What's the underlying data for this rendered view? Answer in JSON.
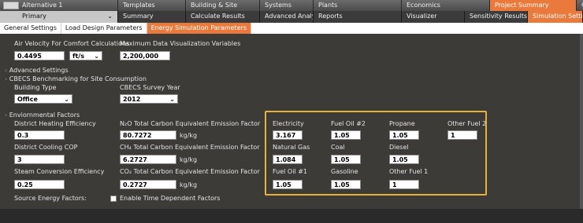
{
  "top_tabs": [
    {
      "label": "Alternative 1",
      "active": false
    },
    {
      "label": "Templates",
      "active": false
    },
    {
      "label": "Building & Site",
      "active": false
    },
    {
      "label": "Systems",
      "active": false
    },
    {
      "label": "Plants",
      "active": false
    },
    {
      "label": "Economics",
      "active": false
    },
    {
      "label": "Project Summary",
      "active": true
    },
    {
      "label": "C",
      "active": false
    }
  ],
  "second_tabs": [
    {
      "label": "Primary"
    },
    {
      "label": "Summary"
    },
    {
      "label": "Calculate Results"
    },
    {
      "label": "Advanced Analytics"
    },
    {
      "label": "Reports"
    },
    {
      "label": "Visualizer"
    },
    {
      "label": "Sensitivity Results"
    },
    {
      "label": "Simulation Settings",
      "active": true
    }
  ],
  "third_tabs": [
    {
      "label": "General Settings"
    },
    {
      "label": "Load Design Parameters"
    },
    {
      "label": "Energy Simulation Parameters",
      "active": true
    }
  ],
  "form": {
    "air_velocity_label": "Air Velocity For Comfort Calculations",
    "air_velocity_value": "0.4495",
    "air_velocity_unit": "ft/s",
    "max_vis_label": "Maximum Data Visualization Variables",
    "max_vis_value": "2,200,000",
    "advanced_settings": "Advanced Settings",
    "cbecs_header": "CBECS Benchmarking for Site Consumption",
    "building_type_label": "Building Type",
    "building_type_value": "Office",
    "cbecs_year_label": "CBECS Survey Year",
    "cbecs_year_value": "2012",
    "env_factors": "Enviornmental Factors",
    "district_heating_label": "District Heating Efficiency",
    "district_heating_value": "0.3",
    "n2o_label": "N₂O Total Carbon Equivalent Emission Factor",
    "n2o_value": "80.7272",
    "n2o_unit": "kg/kg",
    "district_cooling_label": "District Cooling COP",
    "district_cooling_value": "3",
    "ch4_label": "CH₄ Total Carbon Equivalent Emission Factor",
    "ch4_value": "6.2727",
    "ch4_unit": "kg/kg",
    "steam_label": "Steam Conversion Efficiency",
    "steam_value": "0.25",
    "co2_label": "CO₂ Total Carbon Equivalent Emission Factor",
    "co2_value": "0.2727",
    "co2_unit": "kg/kg",
    "source_energy_label": "Source Energy Factors:",
    "time_dependent_label": "Enable Time Dependent Factors"
  },
  "fuel": {
    "electricity_label": "Electricity",
    "electricity_value": "3.167",
    "fuel_oil2_label": "Fuel Oil #2",
    "fuel_oil2_value": "1.05",
    "propane_label": "Propane",
    "propane_value": "1.05",
    "other_fuel2_label": "Other Fuel 2",
    "other_fuel2_value": "1",
    "natural_gas_label": "Natural Gas",
    "natural_gas_value": "1.084",
    "coal_label": "Coal",
    "coal_value": "1.05",
    "diesel_label": "Diesel",
    "diesel_value": "1.05",
    "fuel_oil1_label": "Fuel Oil #1",
    "fuel_oil1_value": "1.05",
    "gasoline_label": "Gasoline",
    "gasoline_value": "1.05",
    "other_fuel1_label": "Other Fuel 1",
    "other_fuel1_value": "1"
  },
  "colors": {
    "accent": "#ea7a3b",
    "highlight": "#e6b23a",
    "background": "#3c3b38"
  }
}
